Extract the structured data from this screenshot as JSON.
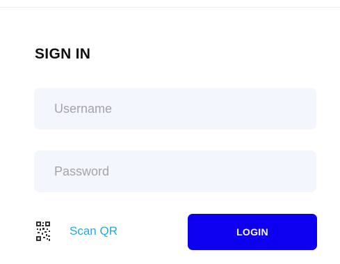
{
  "form": {
    "title": "SIGN IN",
    "username": {
      "value": "",
      "placeholder": "Username"
    },
    "password": {
      "value": "",
      "placeholder": "Password"
    },
    "scan_qr": {
      "label": "Scan QR",
      "icon": "qr-code-icon"
    },
    "login_button": {
      "label": "LOGIN"
    }
  },
  "colors": {
    "background": "#ffffff",
    "input_background": "#f4f6fd",
    "placeholder_text": "#a3a3a8",
    "link_text": "#26a7e0",
    "primary_button": "#0d00ee",
    "button_text": "#ffffff",
    "title_text": "#111111"
  }
}
